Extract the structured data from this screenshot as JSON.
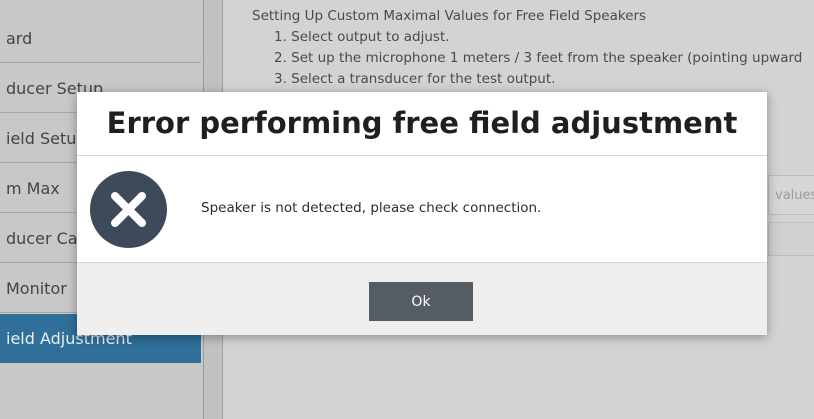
{
  "sidebar": {
    "items": [
      {
        "label": "ard"
      },
      {
        "label": "ducer Setup"
      },
      {
        "label": "ield Setu"
      },
      {
        "label": "m Max"
      },
      {
        "label": "ducer Cal"
      },
      {
        "label": " Monitor"
      },
      {
        "label": "ield Adjustment",
        "active": true
      }
    ]
  },
  "main": {
    "instructions": {
      "title": "Setting Up Custom Maximal Values for Free Field Speakers",
      "steps": [
        "1. Select output to adjust.",
        "2. Set up the microphone 1 meters / 3 feet from the speaker (pointing upward",
        "3. Select a transducer for the test output."
      ]
    },
    "ghost_field_text": "values"
  },
  "dialog": {
    "title": "Error performing free field adjustment",
    "message": "Speaker is not detected, please check connection.",
    "icon": "error-x-icon",
    "ok_label": "Ok"
  },
  "colors": {
    "accent": "#2f6f9a",
    "icon_bg": "#3c4a5a",
    "button": "#565c63"
  }
}
